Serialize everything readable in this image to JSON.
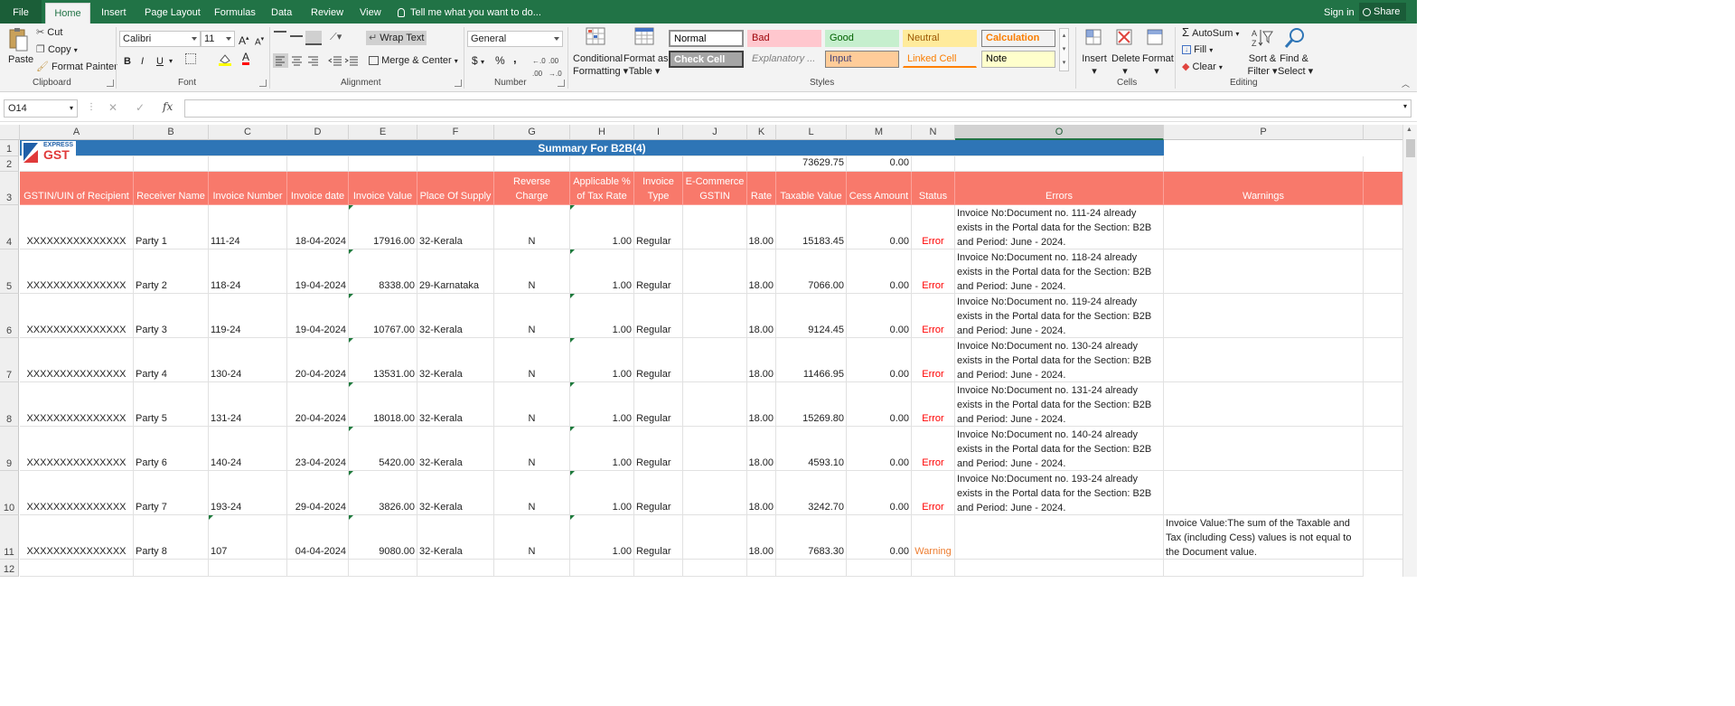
{
  "tabs": {
    "file": "File",
    "home": "Home",
    "insert": "Insert",
    "page_layout": "Page Layout",
    "formulas": "Formulas",
    "data": "Data",
    "review": "Review",
    "view": "View"
  },
  "tell_me": "Tell me what you want to do...",
  "sign_in": "Sign in",
  "share": "Share",
  "ribbon": {
    "clipboard": {
      "paste": "Paste",
      "cut": "Cut",
      "copy": "Copy",
      "format_painter": "Format Painter",
      "label": "Clipboard"
    },
    "font": {
      "name": "Calibri",
      "size": "11",
      "label": "Font",
      "bold": "B",
      "italic": "I",
      "underline": "U"
    },
    "alignment": {
      "wrap_text": "Wrap Text",
      "merge_center": "Merge & Center",
      "label": "Alignment"
    },
    "number": {
      "format": "General",
      "label": "Number",
      "currency": "$",
      "percent": "%",
      "comma": ","
    },
    "styles": {
      "conditional": "Conditional",
      "conditional2": "Formatting",
      "format_as": "Format as",
      "format_as2": "Table",
      "label": "Styles",
      "cells": [
        "Normal",
        "Bad",
        "Good",
        "Neutral",
        "Calculation",
        "Check Cell",
        "Explanatory ...",
        "Input",
        "Linked Cell",
        "Note"
      ]
    },
    "cells": {
      "insert": "Insert",
      "delete": "Delete",
      "format": "Format",
      "label": "Cells"
    },
    "editing": {
      "autosum": "AutoSum",
      "fill": "Fill",
      "clear": "Clear",
      "sort": "Sort &",
      "sort2": "Filter",
      "find": "Find &",
      "find2": "Select",
      "label": "Editing"
    }
  },
  "name_box": "O14",
  "logo": {
    "line1": "EXPRESS",
    "line2": "GST"
  },
  "columns": [
    "A",
    "B",
    "C",
    "D",
    "E",
    "F",
    "G",
    "H",
    "I",
    "J",
    "K",
    "L",
    "M",
    "N",
    "O",
    "P"
  ],
  "summary_title": "Summary For B2B(4)",
  "totals": {
    "taxable": "73629.75",
    "cess": "0.00"
  },
  "headers": [
    "GSTIN/UIN of Recipient",
    "Receiver Name",
    "Invoice Number",
    "Invoice date",
    "Invoice Value",
    "Place Of Supply",
    "Reverse Charge",
    "Applicable % of Tax Rate",
    "Invoice Type",
    "E-Commerce GSTIN",
    "Rate",
    "Taxable Value",
    "Cess Amount",
    "Status",
    "Errors",
    "Warnings"
  ],
  "rows": [
    {
      "gstin": "XXXXXXXXXXXXXXX",
      "name": "Party 1",
      "inv": "111-24",
      "date": "18-04-2024",
      "value": "17916.00",
      "pos": "32-Kerala",
      "rc": "N",
      "app": "1.00",
      "type": "Regular",
      "ecom": "",
      "rate": "18.00",
      "taxable": "15183.45",
      "cess": "0.00",
      "status": "Error",
      "error": "Invoice No:Document no. 111-24 already exists in the Portal data for the Section: B2B and Period: June - 2024.",
      "warning": ""
    },
    {
      "gstin": "XXXXXXXXXXXXXXX",
      "name": "Party 2",
      "inv": "118-24",
      "date": "19-04-2024",
      "value": "8338.00",
      "pos": "29-Karnataka",
      "rc": "N",
      "app": "1.00",
      "type": "Regular",
      "ecom": "",
      "rate": "18.00",
      "taxable": "7066.00",
      "cess": "0.00",
      "status": "Error",
      "error": "Invoice No:Document no. 118-24 already exists in the Portal data for the Section: B2B and Period: June - 2024.",
      "warning": ""
    },
    {
      "gstin": "XXXXXXXXXXXXXXX",
      "name": "Party 3",
      "inv": "119-24",
      "date": "19-04-2024",
      "value": "10767.00",
      "pos": "32-Kerala",
      "rc": "N",
      "app": "1.00",
      "type": "Regular",
      "ecom": "",
      "rate": "18.00",
      "taxable": "9124.45",
      "cess": "0.00",
      "status": "Error",
      "error": "Invoice No:Document no. 119-24 already exists in the Portal data for the Section: B2B and Period: June - 2024.",
      "warning": ""
    },
    {
      "gstin": "XXXXXXXXXXXXXXX",
      "name": "Party 4",
      "inv": "130-24",
      "date": "20-04-2024",
      "value": "13531.00",
      "pos": "32-Kerala",
      "rc": "N",
      "app": "1.00",
      "type": "Regular",
      "ecom": "",
      "rate": "18.00",
      "taxable": "11466.95",
      "cess": "0.00",
      "status": "Error",
      "error": "Invoice No:Document no. 130-24 already exists in the Portal data for the Section: B2B and Period: June - 2024.",
      "warning": ""
    },
    {
      "gstin": "XXXXXXXXXXXXXXX",
      "name": "Party 5",
      "inv": "131-24",
      "date": "20-04-2024",
      "value": "18018.00",
      "pos": "32-Kerala",
      "rc": "N",
      "app": "1.00",
      "type": "Regular",
      "ecom": "",
      "rate": "18.00",
      "taxable": "15269.80",
      "cess": "0.00",
      "status": "Error",
      "error": "Invoice No:Document no. 131-24 already exists in the Portal data for the Section: B2B and Period: June - 2024.",
      "warning": ""
    },
    {
      "gstin": "XXXXXXXXXXXXXXX",
      "name": "Party 6",
      "inv": "140-24",
      "date": "23-04-2024",
      "value": "5420.00",
      "pos": "32-Kerala",
      "rc": "N",
      "app": "1.00",
      "type": "Regular",
      "ecom": "",
      "rate": "18.00",
      "taxable": "4593.10",
      "cess": "0.00",
      "status": "Error",
      "error": "Invoice No:Document no. 140-24 already exists in the Portal data for the Section: B2B and Period: June - 2024.",
      "warning": ""
    },
    {
      "gstin": "XXXXXXXXXXXXXXX",
      "name": "Party 7",
      "inv": "193-24",
      "date": "29-04-2024",
      "value": "3826.00",
      "pos": "32-Kerala",
      "rc": "N",
      "app": "1.00",
      "type": "Regular",
      "ecom": "",
      "rate": "18.00",
      "taxable": "3242.70",
      "cess": "0.00",
      "status": "Error",
      "error": "Invoice No:Document no. 193-24 already exists in the Portal data for the Section: B2B and Period: June - 2024.",
      "warning": ""
    },
    {
      "gstin": "XXXXXXXXXXXXXXX",
      "name": "Party 8",
      "inv": "107",
      "date": "04-04-2024",
      "value": "9080.00",
      "pos": "32-Kerala",
      "rc": "N",
      "app": "1.00",
      "type": "Regular",
      "ecom": "",
      "rate": "18.00",
      "taxable": "7683.30",
      "cess": "0.00",
      "status": "Warning",
      "error": "",
      "warning": "Invoice Value:The sum of the Taxable and Tax (including Cess) values is not equal to the Document value."
    }
  ],
  "colors": {
    "accent": "#217346",
    "header_fill": "#f8796b",
    "summary_fill": "#2e75b6",
    "error": "#ff0000",
    "warning": "#ed7d31"
  }
}
